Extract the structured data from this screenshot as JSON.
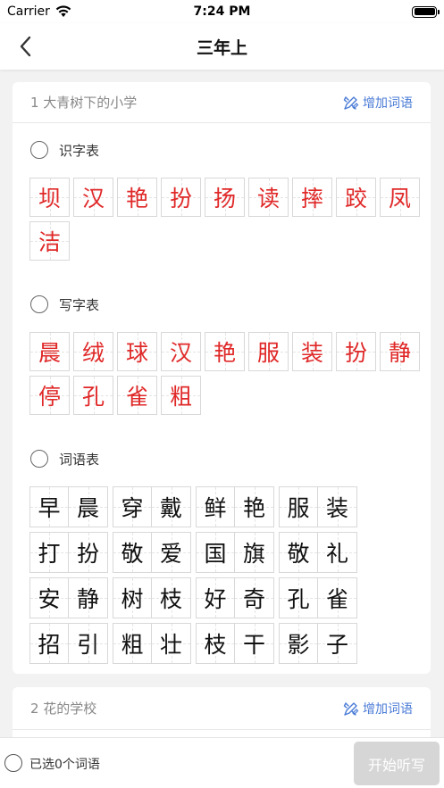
{
  "status_bar": {
    "carrier": "Carrier",
    "time": "7:24 PM"
  },
  "nav": {
    "title": "三年上"
  },
  "lessons": [
    {
      "title": "1 大青树下的小学",
      "add_label": "增加词语",
      "literacy": {
        "label": "识字表",
        "chars": [
          "坝",
          "汉",
          "艳",
          "扮",
          "扬",
          "读",
          "摔",
          "跤",
          "凤",
          "洁"
        ]
      },
      "writing": {
        "label": "写字表",
        "chars": [
          "晨",
          "绒",
          "球",
          "汉",
          "艳",
          "服",
          "装",
          "扮",
          "静",
          "停",
          "孔",
          "雀",
          "粗"
        ]
      },
      "vocab": {
        "label": "词语表",
        "words": [
          "早晨",
          "穿戴",
          "鲜艳",
          "服装",
          "打扮",
          "敬爱",
          "国旗",
          "敬礼",
          "安静",
          "树枝",
          "好奇",
          "孔雀",
          "招引",
          "粗壮",
          "枝干",
          "影子"
        ]
      }
    },
    {
      "title": "2 花的学校",
      "add_label": "增加词语"
    }
  ],
  "bottom": {
    "selected_count": "已选0个词语",
    "start_label": "开始听写"
  },
  "colors": {
    "accent": "#4a7bd6",
    "red_char": "#e02828",
    "button_disabled": "#d6d6d6"
  }
}
